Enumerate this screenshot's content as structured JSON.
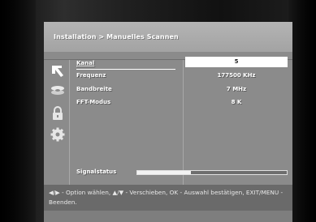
{
  "header": {
    "breadcrumb": "Installation > Manuelles Scannen"
  },
  "sidebar": {
    "icons": [
      "antenna-icon",
      "satellite-dish-icon",
      "lock-icon",
      "gear-icon"
    ]
  },
  "settings": [
    {
      "label": "Kanal",
      "value": "5",
      "selected": true
    },
    {
      "label": "Frequenz",
      "value": "177500 KHz",
      "selected": false
    },
    {
      "label": "Bandbreite",
      "value": "7 MHz",
      "selected": false
    },
    {
      "label": "FFT-Modus",
      "value": "8 K",
      "selected": false
    }
  ],
  "signal": {
    "label": "Signalstatus",
    "level": 0.36
  },
  "help": {
    "text": "◀/▶ - Option wählen, ▲/▼ - Verschieben, OK - Auswahl bestätigen, EXIT/MENU - Beenden."
  },
  "colors": {
    "panel": "#8b8b8b",
    "header": "#a8a8a8",
    "selection": "#ffffff",
    "helpbar": "#6a6a6a"
  }
}
